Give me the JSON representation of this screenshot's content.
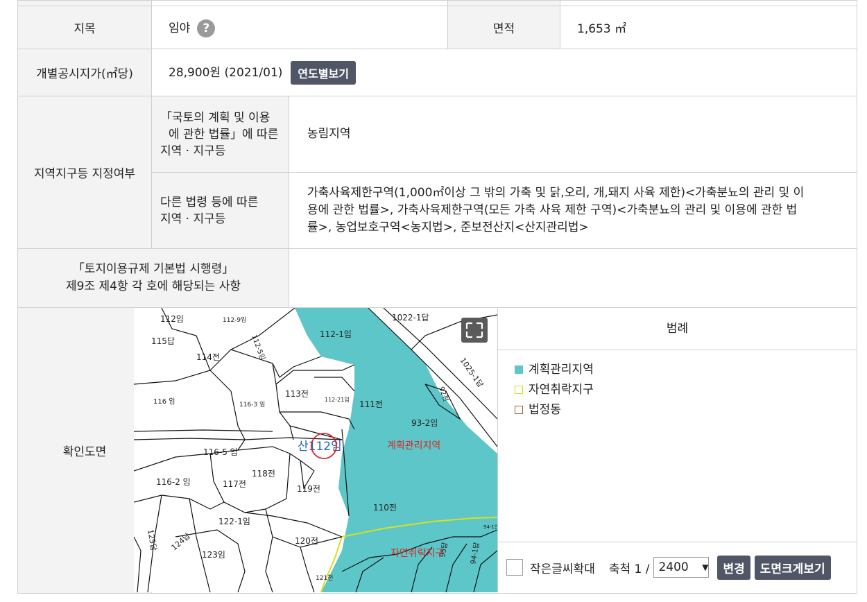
{
  "land": {
    "jimok_label": "지목",
    "jimok_value": "임야",
    "help_icon": "?",
    "area_label": "면적",
    "area_value": "1,653 ㎡",
    "price_label": "개별공시지가(㎡당)",
    "price_value": "28,900원 (2021/01)",
    "price_button": "연도별보기"
  },
  "zoning": {
    "label": "지역지구등 지정여부",
    "row1_label": [
      "「국토의 계획 및 이용",
      "에 관한 법률」에 따른",
      "지역 · 지구등"
    ],
    "row1_value": "농림지역",
    "row2_label": [
      "다른 법령 등에 따른",
      "지역 · 지구등"
    ],
    "row2_value": [
      "가축사육제한구역(1,000㎡이상 그 밖의 가축 및 닭,오리, 개,돼지 사육 제한)<가축분뇨의 관리 및 이",
      "용에 관한 법률>, 가축사육제한구역(모든 가축 사육 제한 구역)<가축분뇨의 관리 및 이용에 관한 법",
      "률>, 농업보호구역<농지법>, 준보전산지<산지관리법>"
    ],
    "decree_label": [
      "「토지이용규제 기본법 시행령」",
      "제9조 제4항 각 호에 해당되는 사항"
    ],
    "decree_value": ""
  },
  "map_section": {
    "label": "확인도면",
    "legend_title": "범례",
    "legend": [
      {
        "label": "계획관리지역",
        "color": "#5cc6c8",
        "filled": true
      },
      {
        "label": "자연취락지구",
        "color": "#d8d820",
        "filled": false
      },
      {
        "label": "법정동",
        "color": "#8b6a3c",
        "filled": false
      }
    ],
    "small_text_label": "작은글씨확대",
    "scale_label": "축척 1 /",
    "scale_value": "2400",
    "change_button": "변경",
    "enlarge_button": "도면크게보기"
  },
  "map": {
    "parcels": [
      "112임",
      "112-9임",
      "115답",
      "114전",
      "112-5임",
      "112-1임",
      "1022-1답",
      "113전",
      "111전",
      "116 임",
      "116-3 임",
      "112-21임",
      "93-2임",
      "1025-1답",
      "92전",
      "116-5 임",
      "118전",
      "116-2 임",
      "117전",
      "119전",
      "122-1임",
      "110전",
      "125답",
      "124답",
      "123임",
      "120전",
      "121천",
      "95답",
      "94-1답",
      "94-1인"
    ],
    "parcel_center": "산112임",
    "zone_label_1": "계획관리지역",
    "zone_label_2": "자연취락지구"
  }
}
